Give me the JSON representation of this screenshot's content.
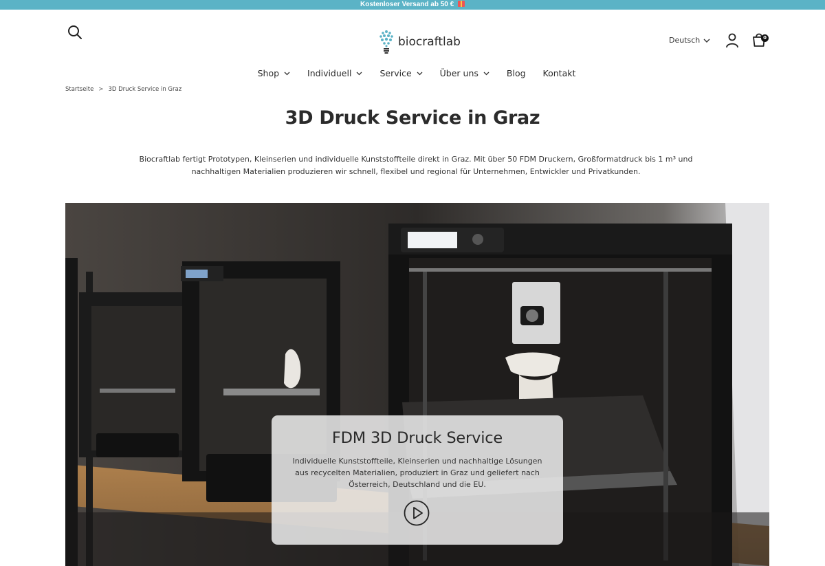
{
  "announcement": {
    "text": "Kostenloser Versand ab 50 €"
  },
  "header": {
    "logo_text": "biocraftlab",
    "language": "Deutsch",
    "cart_count": "0"
  },
  "nav": {
    "items": [
      {
        "label": "Shop",
        "has_dropdown": true
      },
      {
        "label": "Individuell",
        "has_dropdown": true
      },
      {
        "label": "Service",
        "has_dropdown": true
      },
      {
        "label": "Über uns",
        "has_dropdown": true
      },
      {
        "label": "Blog",
        "has_dropdown": false
      },
      {
        "label": "Kontakt",
        "has_dropdown": false
      }
    ]
  },
  "breadcrumb": {
    "home": "Startseite",
    "separator": ">",
    "current": "3D Druck Service in Graz"
  },
  "page": {
    "title": "3D Druck Service in Graz",
    "intro_line1": "Biocraftlab fertigt Prototypen, Kleinserien und individuelle Kunststoffteile direkt in Graz. Mit über 50 FDM Druckern, Großformatdruck bis 1 m³ und",
    "intro_line2": "nachhaltigen Materialien produzieren wir schnell, flexibel und regional für Unternehmen, Entwickler und Privatkunden."
  },
  "hero": {
    "card_title": "FDM 3D Druck Service",
    "card_line1": "Individuelle Kunststoffteile, Kleinserien und nachhaltige Lösungen",
    "card_line2": "aus recycelten Materialien, produziert in Graz und geliefert nach",
    "card_line3": "Österreich, Deutschland und die EU."
  },
  "colors": {
    "announcement_bg": "#5bb3c6",
    "text": "#2b2b2b",
    "logo_accent": "#5bb3c6"
  }
}
